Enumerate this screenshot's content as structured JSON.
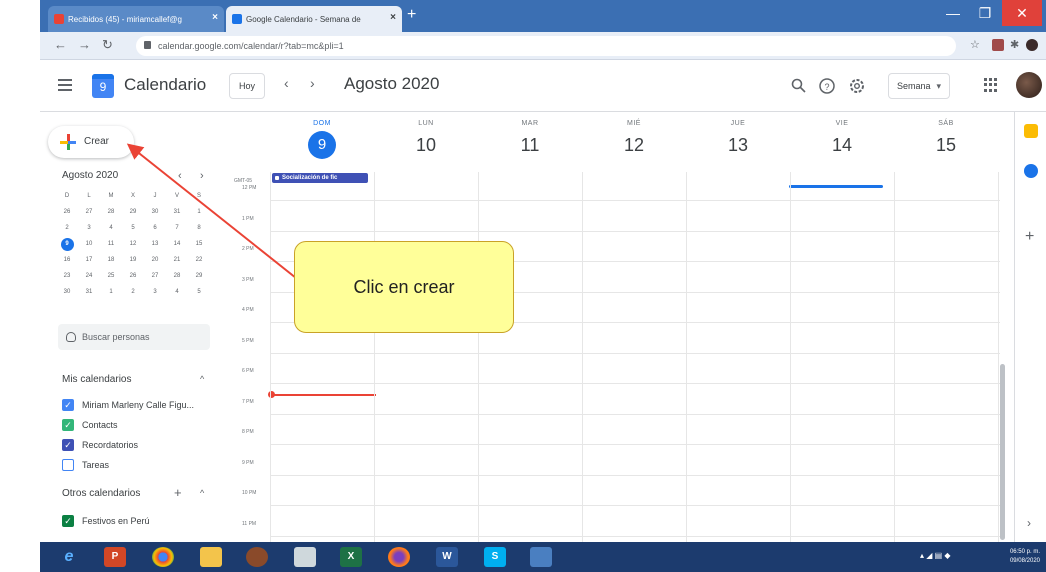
{
  "browser": {
    "tabs": [
      {
        "title": "Recibidos (45) - miriamcallef@g",
        "active": false
      },
      {
        "title": "Google Calendario - Semana de",
        "active": true
      }
    ],
    "url": "calendar.google.com/calendar/r?tab=mc&pli=1",
    "colors": {
      "tabbar": "#3b6fb3",
      "close": "#e0413a"
    }
  },
  "header": {
    "app_title": "Calendario",
    "logo_day": "9",
    "today_label": "Hoy",
    "month_title": "Agosto 2020",
    "view_label": "Semana",
    "icons": [
      "menu-icon",
      "search-icon",
      "help-icon",
      "settings-icon",
      "apps-icon",
      "avatar"
    ]
  },
  "sidebar": {
    "create_label": "Crear",
    "mini_month": "Agosto 2020",
    "weekday_initials": [
      "D",
      "L",
      "M",
      "X",
      "J",
      "V",
      "S"
    ],
    "mini_days": [
      "26",
      "27",
      "28",
      "29",
      "30",
      "31",
      "1",
      "2",
      "3",
      "4",
      "5",
      "6",
      "7",
      "8",
      "9",
      "10",
      "11",
      "12",
      "13",
      "14",
      "15",
      "16",
      "17",
      "18",
      "19",
      "20",
      "21",
      "22",
      "23",
      "24",
      "25",
      "26",
      "27",
      "28",
      "29",
      "30",
      "31",
      "1",
      "2",
      "3",
      "4",
      "5"
    ],
    "today_index": 14,
    "search_people_placeholder": "Buscar personas",
    "my_calendars_title": "Mis calendarios",
    "my_calendars": [
      {
        "label": "Miriam Marleny Calle Figu...",
        "color": "#4285f4",
        "checked": true
      },
      {
        "label": "Contacts",
        "color": "#33b679",
        "checked": true
      },
      {
        "label": "Recordatorios",
        "color": "#3f51b5",
        "checked": true
      },
      {
        "label": "Tareas",
        "color": "#4285f4",
        "checked": false
      }
    ],
    "other_calendars_title": "Otros calendarios",
    "other_calendars": [
      {
        "label": "Festivos en Perú",
        "color": "#0b8043",
        "checked": true
      }
    ]
  },
  "week": {
    "days": [
      {
        "dow": "DOM",
        "num": "9",
        "today": true
      },
      {
        "dow": "LUN",
        "num": "10",
        "today": false
      },
      {
        "dow": "MAR",
        "num": "11",
        "today": false
      },
      {
        "dow": "MIÉ",
        "num": "12",
        "today": false
      },
      {
        "dow": "JUE",
        "num": "13",
        "today": false
      },
      {
        "dow": "VIE",
        "num": "14",
        "today": false
      },
      {
        "dow": "SÁB",
        "num": "15",
        "today": false
      }
    ],
    "timezone_label": "GMT-05",
    "hours": [
      "12 PM",
      "1 PM",
      "2 PM",
      "3 PM",
      "4 PM",
      "5 PM",
      "6 PM",
      "7 PM",
      "8 PM",
      "9 PM",
      "10 PM",
      "11 PM"
    ],
    "all_day_event": "Socialización de fic",
    "accent": "#1a73e8",
    "now_color": "#ea4335"
  },
  "callout": {
    "text": "Clic en crear",
    "fill": "#ffff99"
  },
  "taskbar": {
    "apps": [
      "ie-icon",
      "powerpoint-icon",
      "chrome-icon",
      "explorer-icon",
      "app-icon",
      "notepad-icon",
      "excel-icon",
      "firefox-icon",
      "word-icon",
      "skype-icon",
      "window-icon"
    ],
    "clock_time": "06:50 p. m.",
    "clock_date": "09/08/2020"
  }
}
